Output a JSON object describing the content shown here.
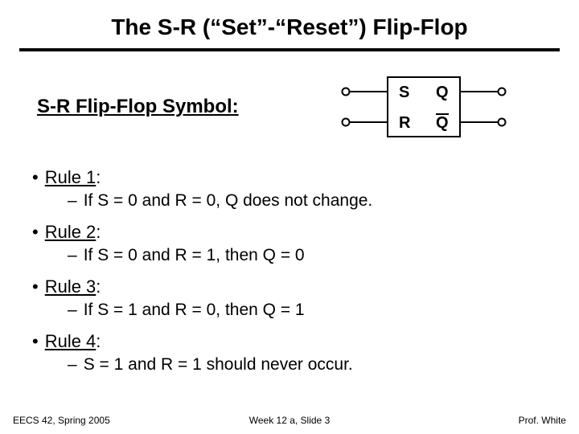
{
  "title": "The S-R (“Set”-“Reset”) Flip-Flop",
  "symbol_label": "S-R Flip-Flop Symbol:",
  "ff": {
    "s": "S",
    "q": "Q",
    "r": "R",
    "qbar": "Q"
  },
  "rules": [
    {
      "name": "Rule 1",
      "text": "If S = 0 and R = 0, Q does not change."
    },
    {
      "name": "Rule 2",
      "text": "If S = 0 and R = 1, then Q = 0"
    },
    {
      "name": "Rule 3",
      "text": "If S = 1 and R = 0, then Q = 1"
    },
    {
      "name": "Rule 4",
      "text": "S = 1 and R = 1 should never occur."
    }
  ],
  "footer": {
    "left": "EECS 42, Spring 2005",
    "center": "Week 12 a, Slide 3",
    "right": "Prof. White"
  }
}
